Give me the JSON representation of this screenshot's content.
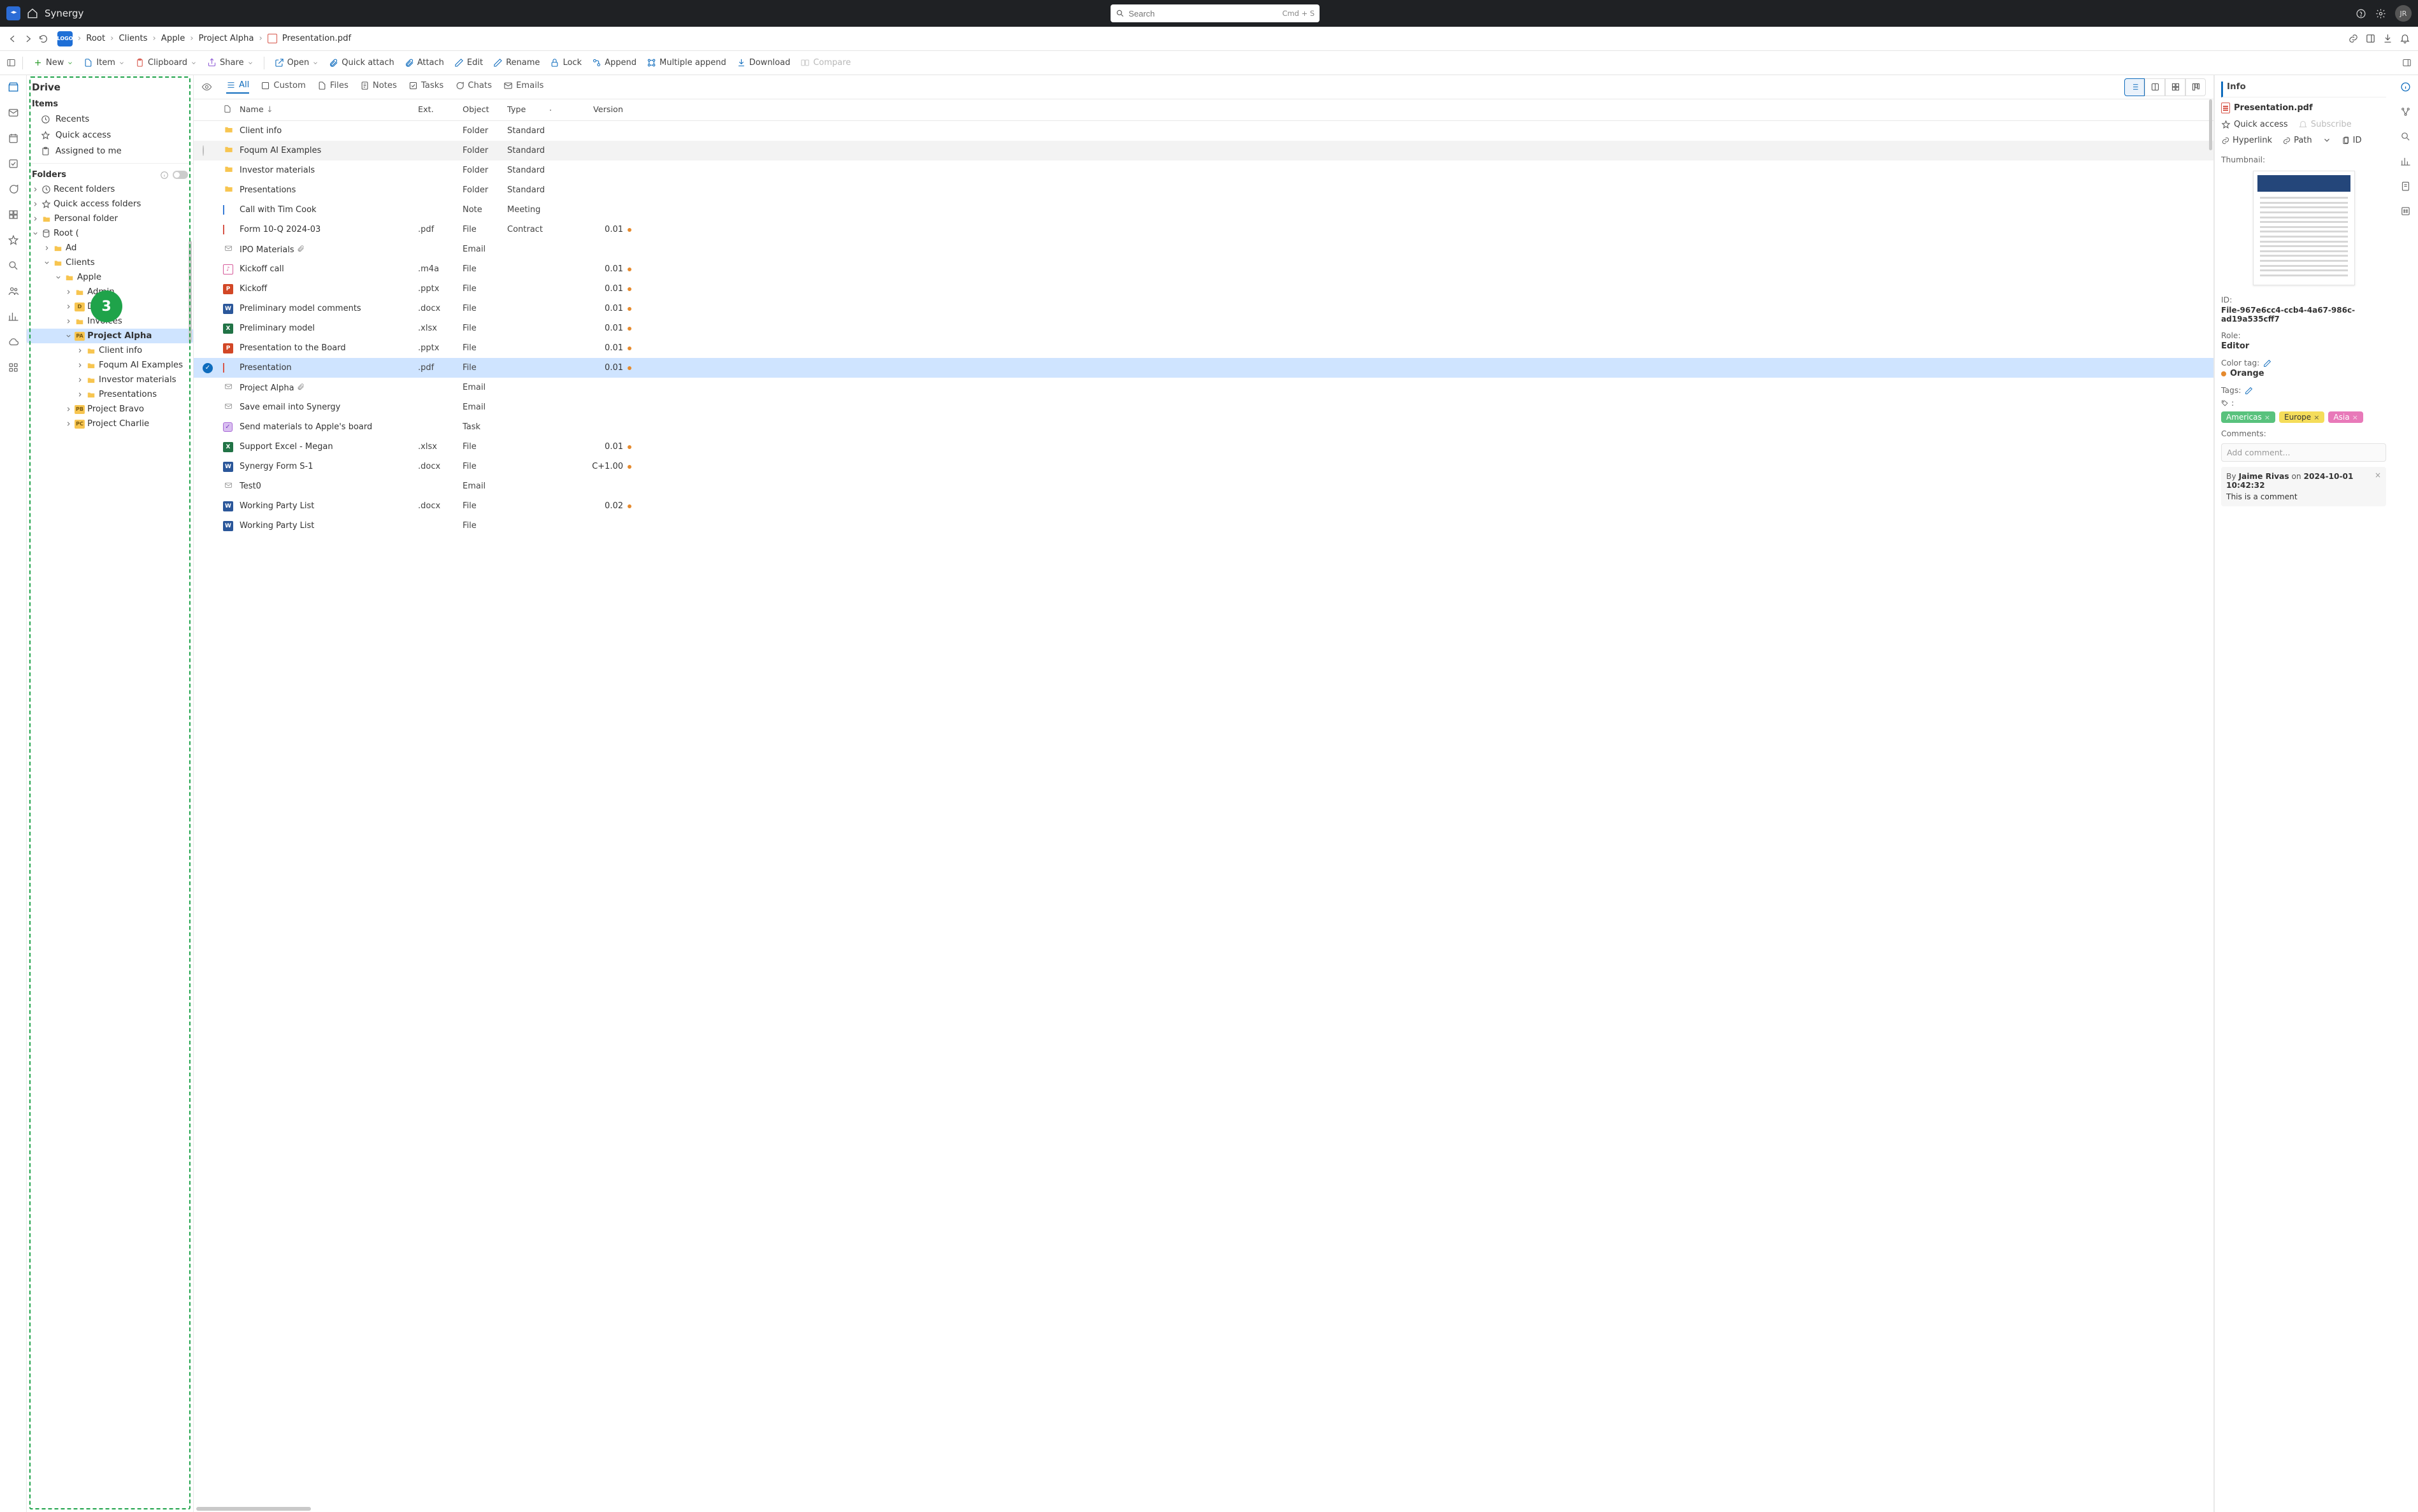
{
  "app": {
    "title": "Synergy",
    "avatar": "JR"
  },
  "search": {
    "placeholder": "Search",
    "shortcut": "Cmd + S"
  },
  "breadcrumb": {
    "items": [
      "Root",
      "Clients",
      "Apple",
      "Project Alpha",
      "Presentation.pdf"
    ]
  },
  "toolbar": {
    "new": "New",
    "item": "Item",
    "clipboard": "Clipboard",
    "share": "Share",
    "open": "Open",
    "quick_attach": "Quick attach",
    "attach": "Attach",
    "edit": "Edit",
    "rename": "Rename",
    "lock": "Lock",
    "append": "Append",
    "multi_append": "Multiple append",
    "download": "Download",
    "compare": "Compare"
  },
  "sidebar": {
    "title": "Drive",
    "items_header": "Items",
    "items": {
      "recents": "Recents",
      "quick_access": "Quick access",
      "assigned": "Assigned to me"
    },
    "folders_header": "Folders",
    "folders": {
      "recent": "Recent folders",
      "qa": "Quick access folders",
      "personal": "Personal folder"
    },
    "tree": {
      "root": "Root (",
      "admin": "Ad",
      "clients": "Clients",
      "apple": "Apple",
      "apple_children": {
        "admin": "Admin",
        "demo": "Demo",
        "invoices": "Invoices",
        "project_alpha": "Project Alpha"
      },
      "pa_children": {
        "client_info": "Client info",
        "foqum": "Foqum AI Examples",
        "investor": "Investor materials",
        "presentations": "Presentations"
      },
      "bravo": "Project Bravo",
      "charlie": "Project Charlie"
    },
    "badge": "3"
  },
  "tabs": {
    "all": "All",
    "custom": "Custom",
    "files": "Files",
    "notes": "Notes",
    "tasks": "Tasks",
    "chats": "Chats",
    "emails": "Emails"
  },
  "table": {
    "headers": {
      "name": "Name",
      "ext": "Ext.",
      "object": "Object",
      "type": "Type",
      "version": "Version"
    },
    "rows": [
      {
        "icon": "folder",
        "name": "Client info",
        "ext": "",
        "object": "Folder",
        "type": "Standard",
        "version": "",
        "dot": false
      },
      {
        "icon": "folder",
        "name": "Foqum AI Examples",
        "ext": "",
        "object": "Folder",
        "type": "Standard",
        "version": "",
        "dot": false,
        "hover": true
      },
      {
        "icon": "folder",
        "name": "Investor materials",
        "ext": "",
        "object": "Folder",
        "type": "Standard",
        "version": "",
        "dot": false
      },
      {
        "icon": "folder",
        "name": "Presentations",
        "ext": "",
        "object": "Folder",
        "type": "Standard",
        "version": "",
        "dot": false
      },
      {
        "icon": "note",
        "name": "Call with Tim Cook",
        "ext": "",
        "object": "Note",
        "type": "Meeting",
        "version": "",
        "dot": false
      },
      {
        "icon": "pdf",
        "name": "Form 10-Q 2024-03",
        "ext": ".pdf",
        "object": "File",
        "type": "Contract",
        "version": "0.01",
        "dot": true
      },
      {
        "icon": "email",
        "name": "IPO Materials",
        "ext": "",
        "object": "Email",
        "type": "",
        "version": "",
        "dot": false,
        "attach": true
      },
      {
        "icon": "audio",
        "name": "Kickoff call",
        "ext": ".m4a",
        "object": "File",
        "type": "",
        "version": "0.01",
        "dot": true
      },
      {
        "icon": "ppt",
        "name": "Kickoff",
        "ext": ".pptx",
        "object": "File",
        "type": "",
        "version": "0.01",
        "dot": true
      },
      {
        "icon": "word",
        "name": "Preliminary model comments",
        "ext": ".docx",
        "object": "File",
        "type": "",
        "version": "0.01",
        "dot": true
      },
      {
        "icon": "excel",
        "name": "Preliminary model",
        "ext": ".xlsx",
        "object": "File",
        "type": "",
        "version": "0.01",
        "dot": true
      },
      {
        "icon": "ppt",
        "name": "Presentation to the Board",
        "ext": ".pptx",
        "object": "File",
        "type": "",
        "version": "0.01",
        "dot": true
      },
      {
        "icon": "pdf",
        "name": "Presentation",
        "ext": ".pdf",
        "object": "File",
        "type": "",
        "version": "0.01",
        "dot": true,
        "selected": true
      },
      {
        "icon": "email",
        "name": "Project Alpha",
        "ext": "",
        "object": "Email",
        "type": "",
        "version": "",
        "dot": false,
        "attach": true
      },
      {
        "icon": "email",
        "name": "Save email into Synergy",
        "ext": "",
        "object": "Email",
        "type": "",
        "version": "",
        "dot": false
      },
      {
        "icon": "task",
        "name": "Send materials to Apple's board",
        "ext": "",
        "object": "Task",
        "type": "",
        "version": "",
        "dot": false
      },
      {
        "icon": "excel",
        "name": "Support Excel - Megan",
        "ext": ".xlsx",
        "object": "File",
        "type": "",
        "version": "0.01",
        "dot": true
      },
      {
        "icon": "word",
        "name": "Synergy Form S-1",
        "ext": ".docx",
        "object": "File",
        "type": "",
        "version": "C+1.00",
        "dot": true
      },
      {
        "icon": "email",
        "name": "Test0",
        "ext": "",
        "object": "Email",
        "type": "",
        "version": "",
        "dot": false
      },
      {
        "icon": "word",
        "name": "Working Party List",
        "ext": ".docx",
        "object": "File",
        "type": "",
        "version": "0.02",
        "dot": true
      },
      {
        "icon": "word",
        "name": "Working Party List",
        "ext": "",
        "object": "File",
        "type": "",
        "version": "",
        "dot": false
      }
    ]
  },
  "info": {
    "panel_title": "Info",
    "file": "Presentation.pdf",
    "quick_access": "Quick access",
    "subscribe": "Subscribe",
    "hyperlink": "Hyperlink",
    "path": "Path",
    "id_label": "ID",
    "thumbnail_label": "Thumbnail:",
    "id_hdr": "ID:",
    "id_val": "File-967e6cc4-ccb4-4a67-986c-ad19a535cff7",
    "role_hdr": "Role:",
    "role_val": "Editor",
    "color_hdr": "Color tag:",
    "color_val": "Orange",
    "tags_hdr": "Tags:",
    "tags_bullet": ":",
    "tags": {
      "americas": "Americas",
      "europe": "Europe",
      "asia": "Asia"
    },
    "comments_hdr": "Comments:",
    "comment_placeholder": "Add comment...",
    "comment": {
      "by": "By",
      "author": "Jaime Rivas",
      "on": "on",
      "date": "2024-10-01 10:42:32",
      "body": "This is a comment"
    }
  }
}
